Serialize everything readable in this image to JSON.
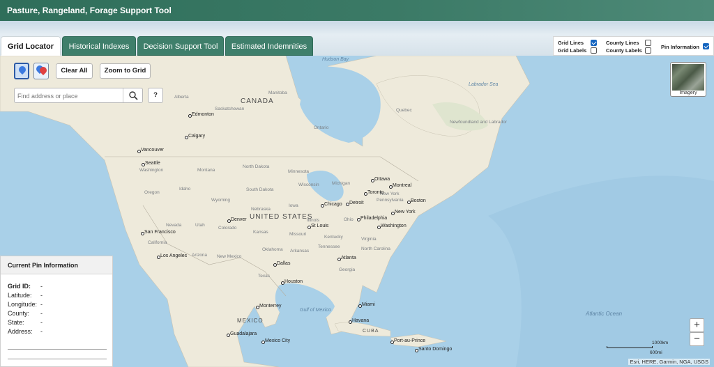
{
  "app": {
    "title": "Pasture, Rangeland, Forage Support Tool"
  },
  "tabs": [
    {
      "label": "Grid Locator",
      "active": true
    },
    {
      "label": "Historical Indexes",
      "active": false
    },
    {
      "label": "Decision Support Tool",
      "active": false
    },
    {
      "label": "Estimated Indemnities",
      "active": false
    }
  ],
  "layers": {
    "grid_lines": {
      "label": "Grid Lines",
      "checked": true
    },
    "grid_labels": {
      "label": "Grid Labels",
      "checked": false
    },
    "county_lines": {
      "label": "County Lines",
      "checked": false
    },
    "county_labels": {
      "label": "County Labels",
      "checked": false
    },
    "pin_information": {
      "label": "Pin Information",
      "checked": true
    }
  },
  "toolbar": {
    "clear_all": "Clear All",
    "zoom_to_grid": "Zoom to Grid",
    "help": "?"
  },
  "search": {
    "placeholder": "Find address or place"
  },
  "basemap": {
    "imagery_label": "Imagery"
  },
  "map_labels": {
    "water": [
      "Hudson Bay",
      "Labrador Sea",
      "Gulf of Mexico",
      "Atlantic Ocean"
    ],
    "countries": [
      "CANADA",
      "UNITED STATES",
      "MEXICO",
      "CUBA"
    ],
    "regions": [
      "Alberta",
      "Manitoba",
      "Saskatchewan",
      "Ontario",
      "Quebec",
      "Newfoundland and Labrador",
      "Washington",
      "Montana",
      "North Dakota",
      "Oregon",
      "Idaho",
      "Wyoming",
      "South Dakota",
      "Wisconsin",
      "Nevada",
      "Utah",
      "Colorado",
      "Nebraska",
      "Iowa",
      "Illinois",
      "Ohio",
      "Pennsylvania",
      "Kansas",
      "Missouri",
      "Kentucky",
      "Virginia",
      "California",
      "Arizona",
      "New Mexico",
      "Oklahoma",
      "Arkansas",
      "Tennessee",
      "North Carolina",
      "Texas",
      "Georgia",
      "Minnesota",
      "Michigan",
      "New York"
    ],
    "cities": [
      "Edmonton",
      "Calgary",
      "Vancouver",
      "Seattle",
      "Ottawa",
      "Montreal",
      "Toronto",
      "Boston",
      "Chicago",
      "Detroit",
      "New York",
      "Philadelphia",
      "Denver",
      "St Louis",
      "Washington",
      "San Francisco",
      "Los Angeles",
      "Dallas",
      "Atlanta",
      "Houston",
      "Monterrey",
      "Miami",
      "Havana",
      "Guadalajara",
      "Mexico City",
      "Port-au-Prince",
      "Santo Domingo"
    ]
  },
  "pin_panel": {
    "title": "Current Pin Information",
    "fields": [
      {
        "label": "Grid ID:",
        "value": "-"
      },
      {
        "label": "Latitude:",
        "value": "-"
      },
      {
        "label": "Longitude:",
        "value": "-"
      },
      {
        "label": "County:",
        "value": "-"
      },
      {
        "label": "State:",
        "value": "-"
      },
      {
        "label": "Address:",
        "value": "-"
      }
    ]
  },
  "zoom": {
    "in": "+",
    "out": "−"
  },
  "scale": {
    "km": "1000km",
    "mi": "600mi"
  },
  "attribution": "Esri, HERE, Garmin, NGA, USGS",
  "colors": {
    "accent": "#3f7f6b",
    "water": "#a9d0e8",
    "land": "#eeeadb",
    "checkbox": "#1565c0"
  }
}
